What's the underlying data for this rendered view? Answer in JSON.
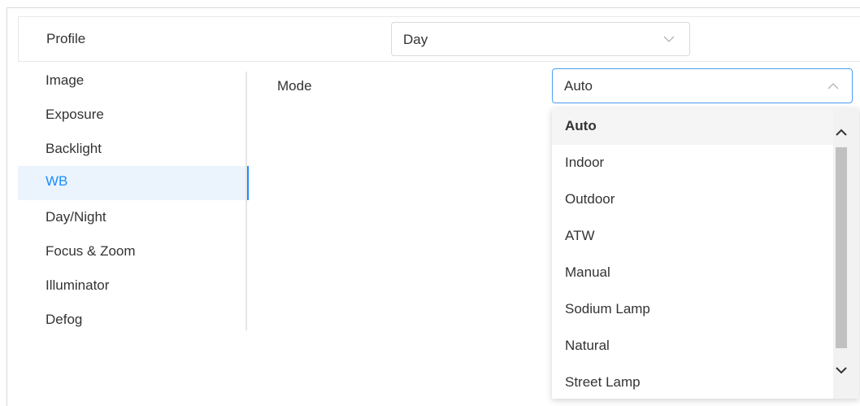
{
  "profile": {
    "label": "Profile",
    "value": "Day"
  },
  "sidebar": {
    "items": [
      {
        "label": "Image"
      },
      {
        "label": "Exposure"
      },
      {
        "label": "Backlight"
      },
      {
        "label": "WB",
        "active": true
      },
      {
        "label": "Day/Night"
      },
      {
        "label": "Focus & Zoom"
      },
      {
        "label": "Illuminator"
      },
      {
        "label": "Defog"
      }
    ]
  },
  "mode": {
    "label": "Mode",
    "value": "Auto",
    "options": [
      "Auto",
      "Indoor",
      "Outdoor",
      "ATW",
      "Manual",
      "Sodium Lamp",
      "Natural",
      "Street Lamp"
    ],
    "selected_index": 0
  },
  "colors": {
    "accent": "#1a8cff",
    "active_bg": "#ebf4fd",
    "focus_border": "#4a9ff5"
  },
  "icons": {
    "profile_select": "chevron-down-icon",
    "mode_select": "chevron-up-icon",
    "scroll_up": "chevron-up-icon",
    "scroll_down": "chevron-down-icon"
  }
}
